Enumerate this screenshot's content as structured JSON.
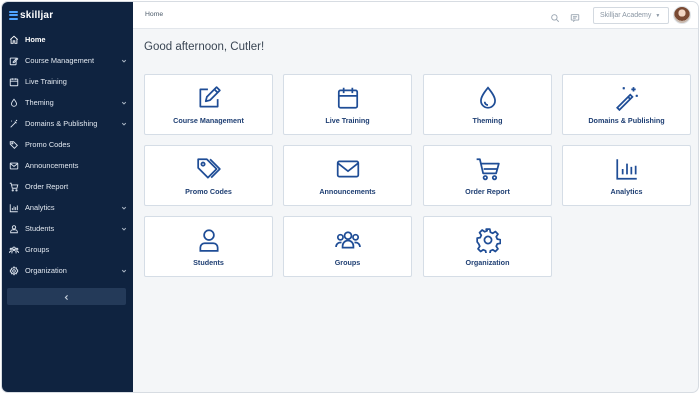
{
  "brand": {
    "name": "skilljar"
  },
  "sidebar": {
    "items": [
      {
        "label": "Home",
        "icon": "home-icon",
        "has_submenu": false,
        "active": true
      },
      {
        "label": "Course Management",
        "icon": "edit-icon",
        "has_submenu": true,
        "active": false
      },
      {
        "label": "Live Training",
        "icon": "calendar-icon",
        "has_submenu": false,
        "active": false
      },
      {
        "label": "Theming",
        "icon": "droplet-icon",
        "has_submenu": true,
        "active": false
      },
      {
        "label": "Domains & Publishing",
        "icon": "magic-wand-icon",
        "has_submenu": true,
        "active": false
      },
      {
        "label": "Promo Codes",
        "icon": "tags-icon",
        "has_submenu": false,
        "active": false
      },
      {
        "label": "Announcements",
        "icon": "envelope-icon",
        "has_submenu": false,
        "active": false
      },
      {
        "label": "Order Report",
        "icon": "cart-icon",
        "has_submenu": false,
        "active": false
      },
      {
        "label": "Analytics",
        "icon": "chart-icon",
        "has_submenu": true,
        "active": false
      },
      {
        "label": "Students",
        "icon": "user-icon",
        "has_submenu": true,
        "active": false
      },
      {
        "label": "Groups",
        "icon": "users-icon",
        "has_submenu": false,
        "active": false
      },
      {
        "label": "Organization",
        "icon": "gear-icon",
        "has_submenu": true,
        "active": false
      }
    ],
    "collapse_icon": "chevron-left-icon"
  },
  "topbar": {
    "breadcrumb": "Home",
    "org_selector": "Skilljar Academy",
    "search_icon": "search-icon",
    "messages_icon": "message-icon"
  },
  "main": {
    "greeting": "Good afternoon, Cutler!",
    "cards": [
      {
        "label": "Course Management",
        "icon": "edit-icon"
      },
      {
        "label": "Live Training",
        "icon": "calendar-icon"
      },
      {
        "label": "Theming",
        "icon": "droplet-icon"
      },
      {
        "label": "Domains & Publishing",
        "icon": "magic-wand-icon"
      },
      {
        "label": "Promo Codes",
        "icon": "tags-icon"
      },
      {
        "label": "Announcements",
        "icon": "envelope-icon"
      },
      {
        "label": "Order Report",
        "icon": "cart-icon"
      },
      {
        "label": "Analytics",
        "icon": "chart-icon"
      },
      {
        "label": "Students",
        "icon": "user-icon"
      },
      {
        "label": "Groups",
        "icon": "users-icon"
      },
      {
        "label": "Organization",
        "icon": "gear-icon"
      }
    ]
  },
  "colors": {
    "sidebar_bg": "#0f2340",
    "accent_icon": "#1f4d96",
    "card_label": "#1f3f73",
    "page_bg": "#f4f6f8"
  }
}
